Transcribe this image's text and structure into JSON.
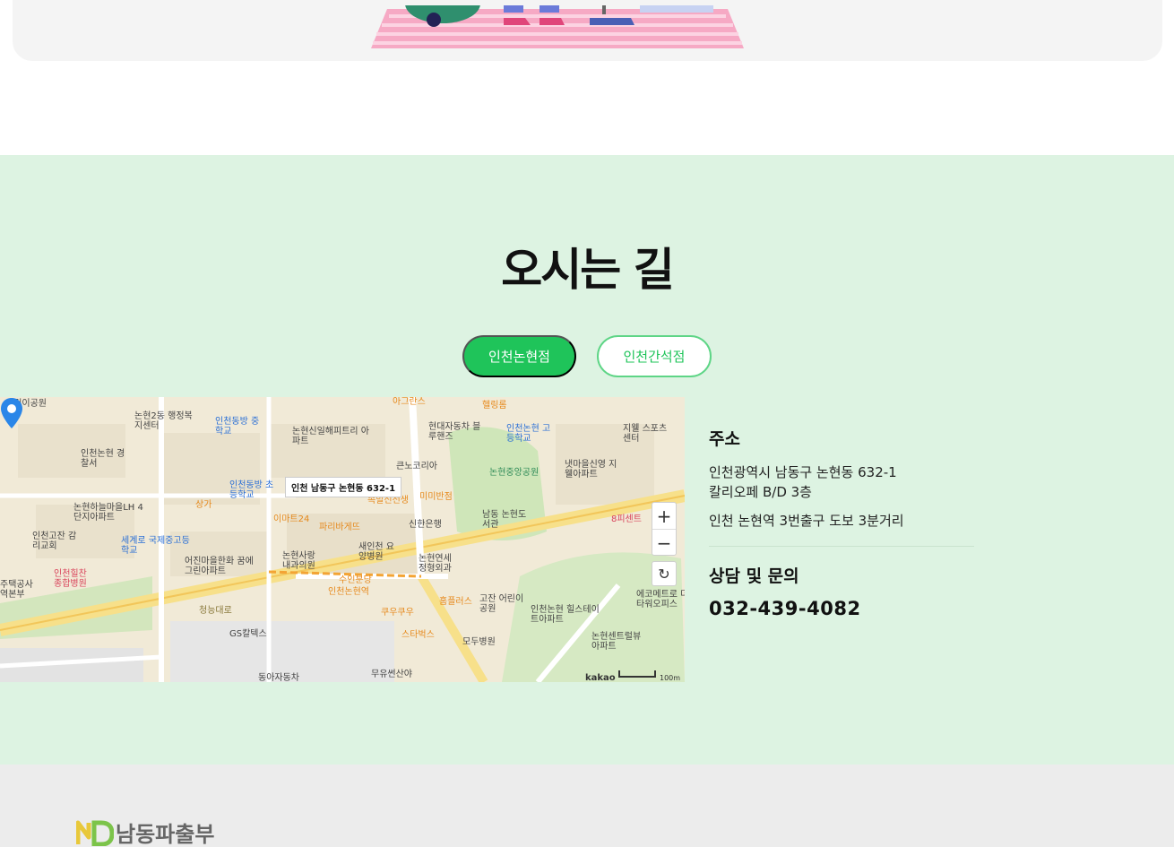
{
  "directions": {
    "title": "오시는 길",
    "tabs": [
      {
        "label": "인천논현점",
        "active": true
      },
      {
        "label": "인천간석점",
        "active": false
      }
    ]
  },
  "map": {
    "callout": "인천 남동구 논현동 632-1",
    "credit": "kakao",
    "scale_label": "100m",
    "zoom_in": "+",
    "zoom_out": "−",
    "reset": "↻",
    "labels": [
      "어린이공원",
      "논현2동 행정복지센터",
      "인천동방 중학교",
      "논현신일해피트리 아파트",
      "아그란스",
      "현대자동차 블루핸즈",
      "헬링롬",
      "인천논현 고등학교",
      "지웰 스포츠센터",
      "인천논현 경찰서",
      "인천동방 초등학교",
      "큰노코리아",
      "논현중앙공원",
      "냇마을신영 지웰아파트",
      "족발신선생",
      "미미반점",
      "인천고잔 감리교회",
      "세계로 국제중고등학교",
      "논현하늘마을LH 4단지아파트",
      "상가",
      "이마트24",
      "신한은행",
      "남동 논현도서관",
      "8피센트",
      "새인천 요양병원",
      "논현사랑 내과의원",
      "논현연세 정형외과",
      "어진마을한화 꿈에그린아파트",
      "인천힐찬 종합병원",
      "수인분당",
      "인천논현역",
      "쿠우쿠우",
      "홈플러스",
      "고잔 어린이공원",
      "인천논현 힐스테이트아파트",
      "에코메트로 더타워오피스",
      "GS칼텍스",
      "스타벅스",
      "모두병원",
      "논현센트럴뷰 아파트",
      "동아자동차",
      "무유썬산야",
      "청능대로",
      "주택공사 역본부",
      "파리바게뜨"
    ]
  },
  "info": {
    "address_title": "주소",
    "address_line1": "인천광역시 남동구 논현동 632-1",
    "address_line2": "칼리오페 B/D 3층",
    "transit": "인천 논현역 3번출구 도보 3분거리",
    "contact_title": "상담 및 문의",
    "phone": "032-439-4082"
  },
  "footer": {
    "logo_text": "남동파출부"
  },
  "colors": {
    "section_bg": "#ddf3e2",
    "accent_green": "#1fc45a",
    "footer_bg": "#ececec",
    "map_pin": "#2a86e8"
  }
}
